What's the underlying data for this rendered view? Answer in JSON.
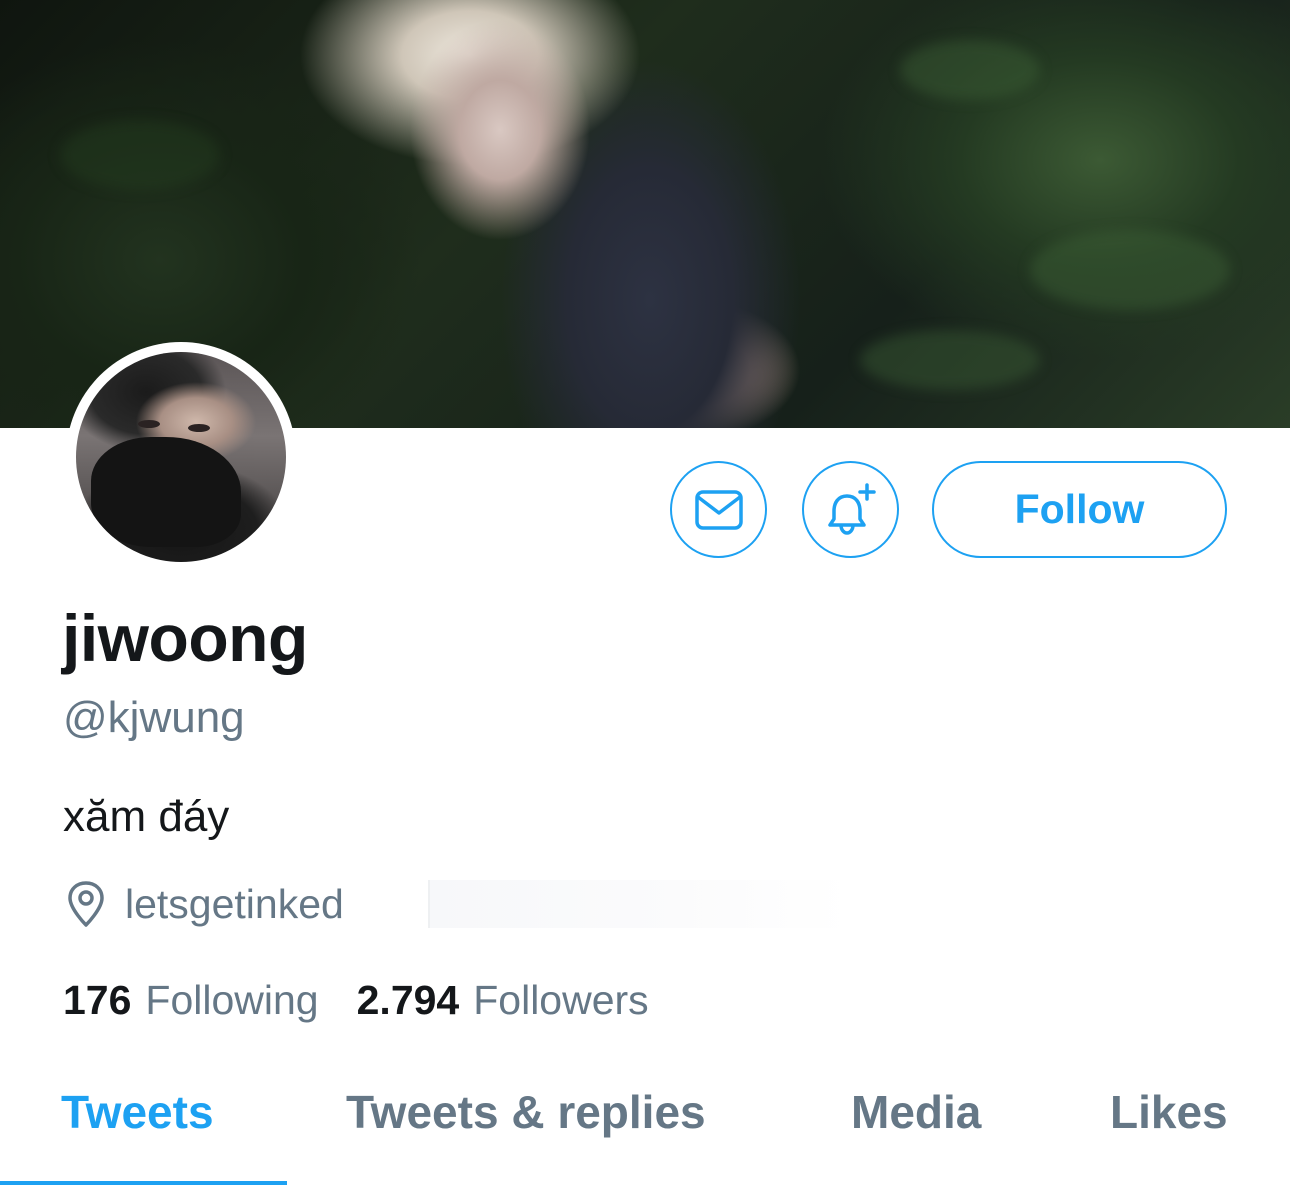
{
  "profile": {
    "display_name": "jiwoong",
    "handle": "@kjwung",
    "bio": "xăm đáy",
    "location": "letsgetinked"
  },
  "actions": {
    "message_icon": "mail-icon",
    "notify_icon": "bell-plus-icon",
    "follow_label": "Follow"
  },
  "stats": {
    "following_count": "176",
    "following_label": "Following",
    "followers_count": "2.794",
    "followers_label": "Followers"
  },
  "tabs": [
    {
      "label": "Tweets",
      "active": true
    },
    {
      "label": "Tweets & replies",
      "active": false
    },
    {
      "label": "Media",
      "active": false
    },
    {
      "label": "Likes",
      "active": false
    }
  ],
  "colors": {
    "accent": "#1da1f2",
    "secondary_text": "#657786",
    "primary_text": "#14171a"
  }
}
